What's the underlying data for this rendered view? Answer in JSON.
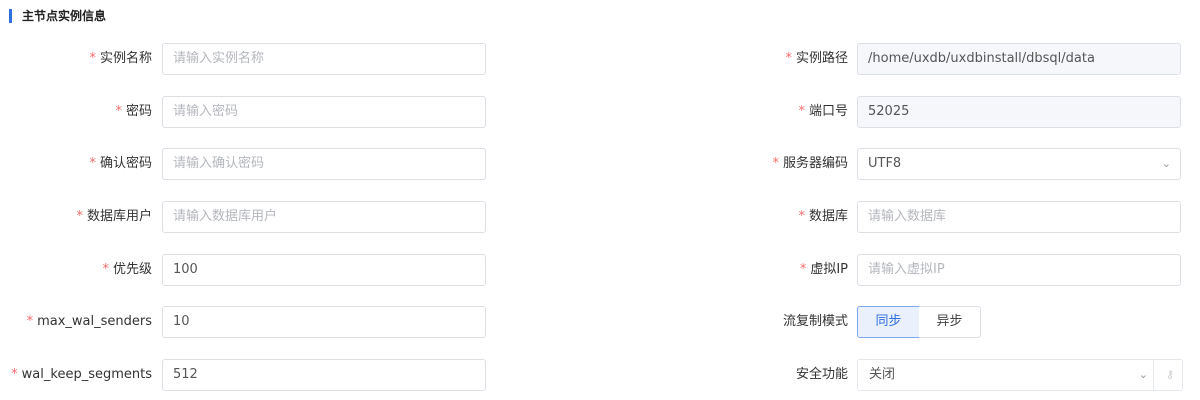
{
  "section": {
    "title": "主节点实例信息",
    "accent_color": "#2f6fe4"
  },
  "required_mark": "*",
  "left_fields": [
    {
      "label": "实例名称",
      "placeholder": "请输入实例名称",
      "value": "",
      "required": true
    },
    {
      "label": "密码",
      "placeholder": "请输入密码",
      "value": "",
      "required": true
    },
    {
      "label": "确认密码",
      "placeholder": "请输入确认密码",
      "value": "",
      "required": true
    },
    {
      "label": "数据库用户",
      "placeholder": "请输入数据库用户",
      "value": "",
      "required": true
    },
    {
      "label": "优先级",
      "placeholder": "",
      "value": "100",
      "required": true
    },
    {
      "label": "max_wal_senders",
      "placeholder": "",
      "value": "10",
      "required": true
    },
    {
      "label": "wal_keep_segments",
      "placeholder": "",
      "value": "512",
      "required": true
    }
  ],
  "right_fields": {
    "instance_path": {
      "label": "实例路径",
      "value": "/home/uxdb/uxdbinstall/dbsql/data",
      "required": true
    },
    "port": {
      "label": "端口号",
      "value": "52025",
      "required": true
    },
    "server_encoding": {
      "label": "服务器编码",
      "value": "UTF8",
      "required": true,
      "icon": "chevron-down-icon"
    },
    "database": {
      "label": "数据库",
      "placeholder": "请输入数据库",
      "required": true
    },
    "virtual_ip": {
      "label": "虚拟IP",
      "placeholder": "请输入虚拟IP",
      "required": true
    },
    "replication_mode": {
      "label": "流复制模式",
      "options": [
        "同步",
        "异步"
      ],
      "selected": "同步"
    },
    "security": {
      "label": "安全功能",
      "value": "关闭",
      "icons": [
        "chevron-down-icon",
        "key-icon"
      ]
    }
  }
}
